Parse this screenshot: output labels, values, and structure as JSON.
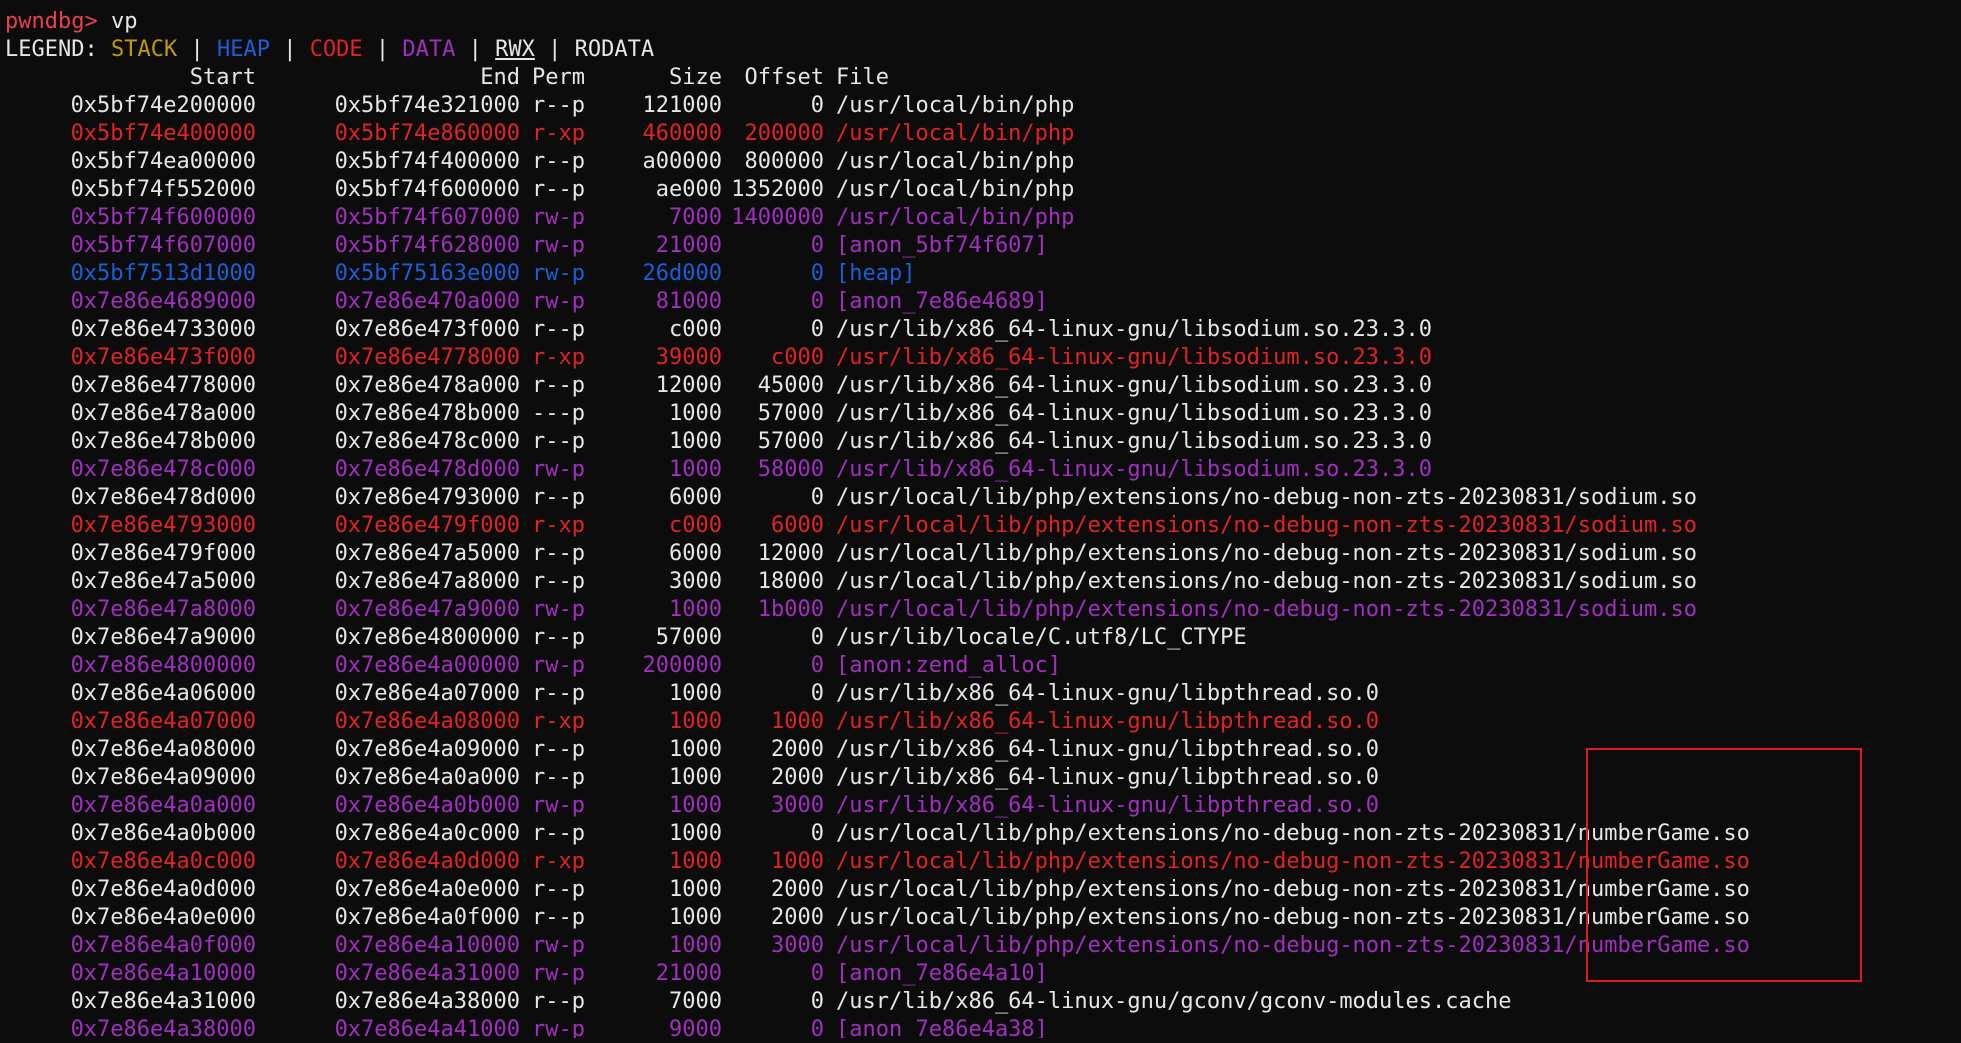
{
  "prompt": {
    "label": "pwndbg>",
    "command": "vp"
  },
  "legend": {
    "label": "LEGEND:",
    "items": [
      {
        "text": "STACK",
        "kind": "stack"
      },
      {
        "text": "HEAP",
        "kind": "heap"
      },
      {
        "text": "CODE",
        "kind": "code"
      },
      {
        "text": "DATA",
        "kind": "data"
      },
      {
        "text": "RWX",
        "kind": "rwx"
      },
      {
        "text": "RODATA",
        "kind": "ro"
      }
    ],
    "separator": "|"
  },
  "columns": {
    "start": "Start",
    "end": "End",
    "perm": "Perm",
    "size": "Size",
    "offset": "Offset",
    "file": "File"
  },
  "colors": {
    "prompt": "#e8404e",
    "stack": "#c19c00",
    "heap": "#1a5fd8",
    "code": "#e02424",
    "data": "#a12fbf",
    "plain": "#e6e6e6",
    "highlight_box": "#e01b1b"
  },
  "rows": [
    {
      "start": "0x5bf74e200000",
      "end": "0x5bf74e321000",
      "perm": "r--p",
      "size": "121000",
      "offset": "0",
      "file": "/usr/local/bin/php",
      "kind": "plain"
    },
    {
      "start": "0x5bf74e400000",
      "end": "0x5bf74e860000",
      "perm": "r-xp",
      "size": "460000",
      "offset": "200000",
      "file": "/usr/local/bin/php",
      "kind": "code"
    },
    {
      "start": "0x5bf74ea00000",
      "end": "0x5bf74f400000",
      "perm": "r--p",
      "size": "a00000",
      "offset": "800000",
      "file": "/usr/local/bin/php",
      "kind": "plain"
    },
    {
      "start": "0x5bf74f552000",
      "end": "0x5bf74f600000",
      "perm": "r--p",
      "size": "ae000",
      "offset": "1352000",
      "file": "/usr/local/bin/php",
      "kind": "plain"
    },
    {
      "start": "0x5bf74f600000",
      "end": "0x5bf74f607000",
      "perm": "rw-p",
      "size": "7000",
      "offset": "1400000",
      "file": "/usr/local/bin/php",
      "kind": "data"
    },
    {
      "start": "0x5bf74f607000",
      "end": "0x5bf74f628000",
      "perm": "rw-p",
      "size": "21000",
      "offset": "0",
      "file": "[anon_5bf74f607]",
      "kind": "data"
    },
    {
      "start": "0x5bf7513d1000",
      "end": "0x5bf75163e000",
      "perm": "rw-p",
      "size": "26d000",
      "offset": "0",
      "file": "[heap]",
      "kind": "heap"
    },
    {
      "start": "0x7e86e4689000",
      "end": "0x7e86e470a000",
      "perm": "rw-p",
      "size": "81000",
      "offset": "0",
      "file": "[anon_7e86e4689]",
      "kind": "data"
    },
    {
      "start": "0x7e86e4733000",
      "end": "0x7e86e473f000",
      "perm": "r--p",
      "size": "c000",
      "offset": "0",
      "file": "/usr/lib/x86_64-linux-gnu/libsodium.so.23.3.0",
      "kind": "plain"
    },
    {
      "start": "0x7e86e473f000",
      "end": "0x7e86e4778000",
      "perm": "r-xp",
      "size": "39000",
      "offset": "c000",
      "file": "/usr/lib/x86_64-linux-gnu/libsodium.so.23.3.0",
      "kind": "code"
    },
    {
      "start": "0x7e86e4778000",
      "end": "0x7e86e478a000",
      "perm": "r--p",
      "size": "12000",
      "offset": "45000",
      "file": "/usr/lib/x86_64-linux-gnu/libsodium.so.23.3.0",
      "kind": "plain"
    },
    {
      "start": "0x7e86e478a000",
      "end": "0x7e86e478b000",
      "perm": "---p",
      "size": "1000",
      "offset": "57000",
      "file": "/usr/lib/x86_64-linux-gnu/libsodium.so.23.3.0",
      "kind": "plain"
    },
    {
      "start": "0x7e86e478b000",
      "end": "0x7e86e478c000",
      "perm": "r--p",
      "size": "1000",
      "offset": "57000",
      "file": "/usr/lib/x86_64-linux-gnu/libsodium.so.23.3.0",
      "kind": "plain"
    },
    {
      "start": "0x7e86e478c000",
      "end": "0x7e86e478d000",
      "perm": "rw-p",
      "size": "1000",
      "offset": "58000",
      "file": "/usr/lib/x86_64-linux-gnu/libsodium.so.23.3.0",
      "kind": "data"
    },
    {
      "start": "0x7e86e478d000",
      "end": "0x7e86e4793000",
      "perm": "r--p",
      "size": "6000",
      "offset": "0",
      "file": "/usr/local/lib/php/extensions/no-debug-non-zts-20230831/sodium.so",
      "kind": "plain"
    },
    {
      "start": "0x7e86e4793000",
      "end": "0x7e86e479f000",
      "perm": "r-xp",
      "size": "c000",
      "offset": "6000",
      "file": "/usr/local/lib/php/extensions/no-debug-non-zts-20230831/sodium.so",
      "kind": "code"
    },
    {
      "start": "0x7e86e479f000",
      "end": "0x7e86e47a5000",
      "perm": "r--p",
      "size": "6000",
      "offset": "12000",
      "file": "/usr/local/lib/php/extensions/no-debug-non-zts-20230831/sodium.so",
      "kind": "plain"
    },
    {
      "start": "0x7e86e47a5000",
      "end": "0x7e86e47a8000",
      "perm": "r--p",
      "size": "3000",
      "offset": "18000",
      "file": "/usr/local/lib/php/extensions/no-debug-non-zts-20230831/sodium.so",
      "kind": "plain"
    },
    {
      "start": "0x7e86e47a8000",
      "end": "0x7e86e47a9000",
      "perm": "rw-p",
      "size": "1000",
      "offset": "1b000",
      "file": "/usr/local/lib/php/extensions/no-debug-non-zts-20230831/sodium.so",
      "kind": "data"
    },
    {
      "start": "0x7e86e47a9000",
      "end": "0x7e86e4800000",
      "perm": "r--p",
      "size": "57000",
      "offset": "0",
      "file": "/usr/lib/locale/C.utf8/LC_CTYPE",
      "kind": "plain"
    },
    {
      "start": "0x7e86e4800000",
      "end": "0x7e86e4a00000",
      "perm": "rw-p",
      "size": "200000",
      "offset": "0",
      "file": "[anon:zend_alloc]",
      "kind": "data"
    },
    {
      "start": "0x7e86e4a06000",
      "end": "0x7e86e4a07000",
      "perm": "r--p",
      "size": "1000",
      "offset": "0",
      "file": "/usr/lib/x86_64-linux-gnu/libpthread.so.0",
      "kind": "plain"
    },
    {
      "start": "0x7e86e4a07000",
      "end": "0x7e86e4a08000",
      "perm": "r-xp",
      "size": "1000",
      "offset": "1000",
      "file": "/usr/lib/x86_64-linux-gnu/libpthread.so.0",
      "kind": "code"
    },
    {
      "start": "0x7e86e4a08000",
      "end": "0x7e86e4a09000",
      "perm": "r--p",
      "size": "1000",
      "offset": "2000",
      "file": "/usr/lib/x86_64-linux-gnu/libpthread.so.0",
      "kind": "plain"
    },
    {
      "start": "0x7e86e4a09000",
      "end": "0x7e86e4a0a000",
      "perm": "r--p",
      "size": "1000",
      "offset": "2000",
      "file": "/usr/lib/x86_64-linux-gnu/libpthread.so.0",
      "kind": "plain"
    },
    {
      "start": "0x7e86e4a0a000",
      "end": "0x7e86e4a0b000",
      "perm": "rw-p",
      "size": "1000",
      "offset": "3000",
      "file": "/usr/lib/x86_64-linux-gnu/libpthread.so.0",
      "kind": "data"
    },
    {
      "start": "0x7e86e4a0b000",
      "end": "0x7e86e4a0c000",
      "perm": "r--p",
      "size": "1000",
      "offset": "0",
      "file": "/usr/local/lib/php/extensions/no-debug-non-zts-20230831/numberGame.so",
      "kind": "plain"
    },
    {
      "start": "0x7e86e4a0c000",
      "end": "0x7e86e4a0d000",
      "perm": "r-xp",
      "size": "1000",
      "offset": "1000",
      "file": "/usr/local/lib/php/extensions/no-debug-non-zts-20230831/numberGame.so",
      "kind": "code"
    },
    {
      "start": "0x7e86e4a0d000",
      "end": "0x7e86e4a0e000",
      "perm": "r--p",
      "size": "1000",
      "offset": "2000",
      "file": "/usr/local/lib/php/extensions/no-debug-non-zts-20230831/numberGame.so",
      "kind": "plain"
    },
    {
      "start": "0x7e86e4a0e000",
      "end": "0x7e86e4a0f000",
      "perm": "r--p",
      "size": "1000",
      "offset": "2000",
      "file": "/usr/local/lib/php/extensions/no-debug-non-zts-20230831/numberGame.so",
      "kind": "plain"
    },
    {
      "start": "0x7e86e4a0f000",
      "end": "0x7e86e4a10000",
      "perm": "rw-p",
      "size": "1000",
      "offset": "3000",
      "file": "/usr/local/lib/php/extensions/no-debug-non-zts-20230831/numberGame.so",
      "kind": "data"
    },
    {
      "start": "0x7e86e4a10000",
      "end": "0x7e86e4a31000",
      "perm": "rw-p",
      "size": "21000",
      "offset": "0",
      "file": "[anon_7e86e4a10]",
      "kind": "data"
    },
    {
      "start": "0x7e86e4a31000",
      "end": "0x7e86e4a38000",
      "perm": "r--p",
      "size": "7000",
      "offset": "0",
      "file": "/usr/lib/x86_64-linux-gnu/gconv/gconv-modules.cache",
      "kind": "plain"
    },
    {
      "start": "0x7e86e4a38000",
      "end": "0x7e86e4a41000",
      "perm": "rw-p",
      "size": "9000",
      "offset": "0",
      "file": "[anon_7e86e4a38]",
      "kind": "data"
    }
  ]
}
